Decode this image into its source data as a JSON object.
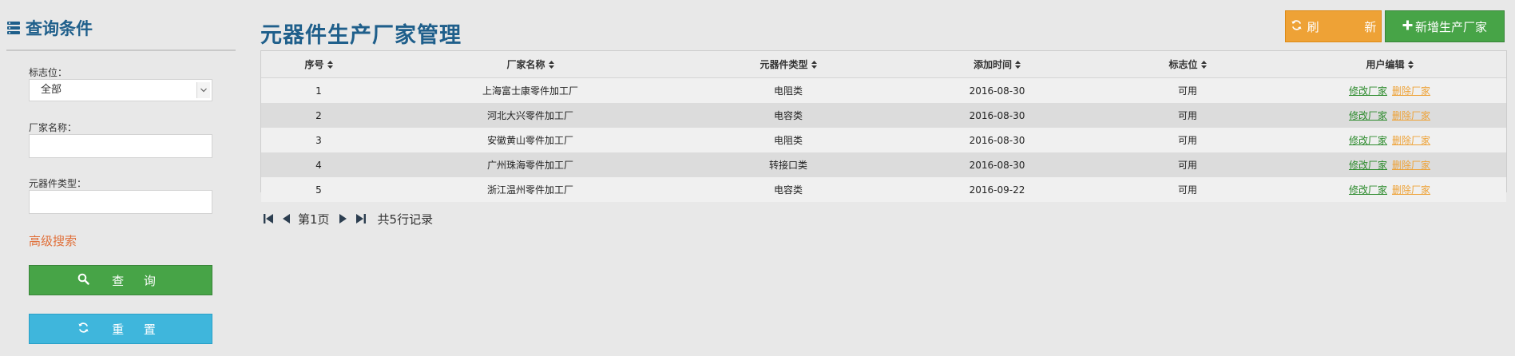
{
  "sidebar": {
    "title": "查询条件",
    "flag_label": "标志位：",
    "flag_value": "全部",
    "vendor_label": "厂家名称：",
    "type_label": "元器件类型：",
    "advanced_search": "高级搜索",
    "query_button": "查 询",
    "reset_button": "重 置"
  },
  "header": {
    "title": "元器件生产厂家管理",
    "refresh_button": "刷 新",
    "add_button": "新增生产厂家"
  },
  "table": {
    "columns": [
      "序号",
      "厂家名称",
      "元器件类型",
      "添加时间",
      "标志位",
      "用户编辑"
    ],
    "rows": [
      {
        "no": "1",
        "name": "上海富士康零件加工厂",
        "type": "电阻类",
        "date": "2016-08-30",
        "flag": "可用",
        "edit": "修改厂家",
        "delete": "删除厂家"
      },
      {
        "no": "2",
        "name": "河北大兴零件加工厂",
        "type": "电容类",
        "date": "2016-08-30",
        "flag": "可用",
        "edit": "修改厂家",
        "delete": "删除厂家"
      },
      {
        "no": "3",
        "name": "安徽黄山零件加工厂",
        "type": "电阻类",
        "date": "2016-08-30",
        "flag": "可用",
        "edit": "修改厂家",
        "delete": "删除厂家"
      },
      {
        "no": "4",
        "name": "广州珠海零件加工厂",
        "type": "转接口类",
        "date": "2016-08-30",
        "flag": "可用",
        "edit": "修改厂家",
        "delete": "删除厂家"
      },
      {
        "no": "5",
        "name": "浙江温州零件加工厂",
        "type": "电容类",
        "date": "2016-09-22",
        "flag": "可用",
        "edit": "修改厂家",
        "delete": "删除厂家"
      }
    ]
  },
  "pager": {
    "page_label": "第1页",
    "total_label": "共5行记录"
  },
  "icons": {
    "sidebar_title": "list-icon",
    "query": "search-icon",
    "reset": "refresh-icon",
    "refresh": "refresh-icon",
    "add": "plus-icon",
    "sort": "sort-icon",
    "first": "first-page-icon",
    "prev": "prev-page-icon",
    "next": "next-page-icon",
    "last": "last-page-icon"
  },
  "colors": {
    "title": "#1f5f8b",
    "green_button": "#47a447",
    "cyan_button": "#3fb6dc",
    "orange_button": "#eea236",
    "advanced_link": "#e0703a"
  }
}
